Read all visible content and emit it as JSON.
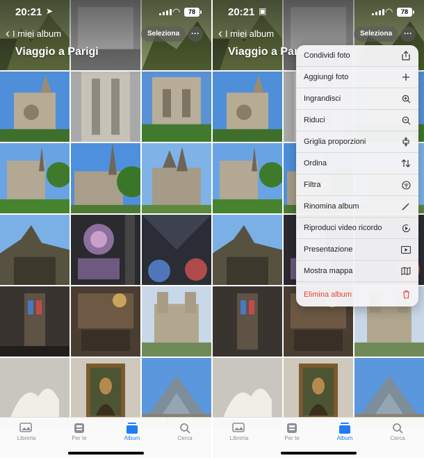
{
  "status_bar": {
    "time": "20:21",
    "battery": "78"
  },
  "header": {
    "back_label": "I miei album",
    "title": "Viaggio a Parigi",
    "select_label": "Seleziona",
    "more_icon": "ellipsis-icon"
  },
  "tabs": [
    {
      "label": "Libreria",
      "icon": "photo-library-icon",
      "active": false
    },
    {
      "label": "Per te",
      "icon": "for-you-icon",
      "active": false
    },
    {
      "label": "Album",
      "icon": "album-icon",
      "active": true
    },
    {
      "label": "Cerca",
      "icon": "search-icon",
      "active": false
    }
  ],
  "menu": {
    "items": [
      {
        "label": "Condividi foto",
        "icon": "share-icon"
      },
      {
        "label": "Aggiungi foto",
        "icon": "plus-icon"
      },
      {
        "label": "Ingrandisci",
        "icon": "zoom-in-icon"
      },
      {
        "label": "Riduci",
        "icon": "zoom-out-icon"
      },
      {
        "label": "Griglia proporzioni",
        "icon": "aspect-grid-icon"
      },
      {
        "label": "Ordina",
        "icon": "sort-icon"
      },
      {
        "label": "Filtra",
        "icon": "filter-icon"
      },
      {
        "label": "Rinomina album",
        "icon": "pencil-icon"
      },
      {
        "label": "Riproduci video ricordo",
        "icon": "memory-play-icon"
      },
      {
        "label": "Presentazione",
        "icon": "slideshow-icon"
      },
      {
        "label": "Mostra mappa",
        "icon": "map-icon"
      },
      {
        "label": "Elimina album",
        "icon": "trash-icon",
        "destructive": true
      }
    ]
  },
  "colors": {
    "accent": "#1f7cf5",
    "destructive": "#e8403a"
  }
}
